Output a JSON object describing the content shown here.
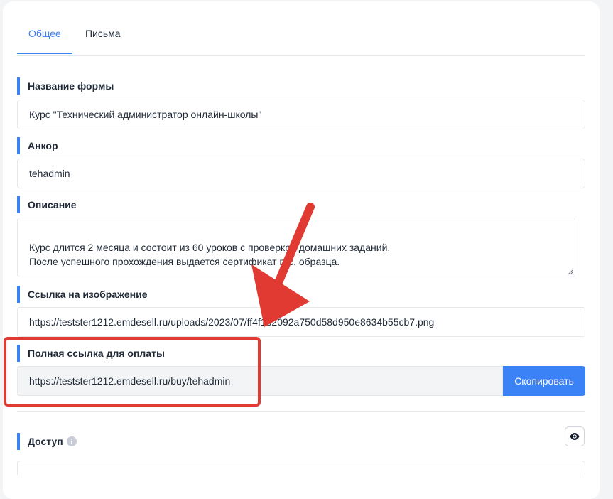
{
  "tabs": [
    {
      "label": "Общее",
      "active": true
    },
    {
      "label": "Письма",
      "active": false
    }
  ],
  "form_name": {
    "label": "Название формы",
    "value": "Курс \"Технический администратор онлайн-школы\""
  },
  "anchor": {
    "label": "Анкор",
    "value": "tehadmin"
  },
  "description": {
    "label": "Описание",
    "value": "Курс длится 2 месяца и состоит из 60 уроков с проверкой домашних заданий.\nПосле успешного прохождения выдается сертификат гос. образца."
  },
  "image_link": {
    "label": "Ссылка на изображение",
    "value": "https://testster1212.emdesell.ru/uploads/2023/07/ff4f1b2092a750d58d950e8634b55cb7.png"
  },
  "payment_link": {
    "label": "Полная ссылка для оплаты",
    "value": "https://testster1212.emdesell.ru/buy/tehadmin",
    "copy_label": "Скопировать"
  },
  "access": {
    "label": "Доступ"
  },
  "icons": {
    "info": "info-icon",
    "eye": "eye-icon",
    "resize": "resize-handle-icon"
  },
  "colors": {
    "accent": "#3b82f6",
    "annotation": "#e03a32"
  }
}
